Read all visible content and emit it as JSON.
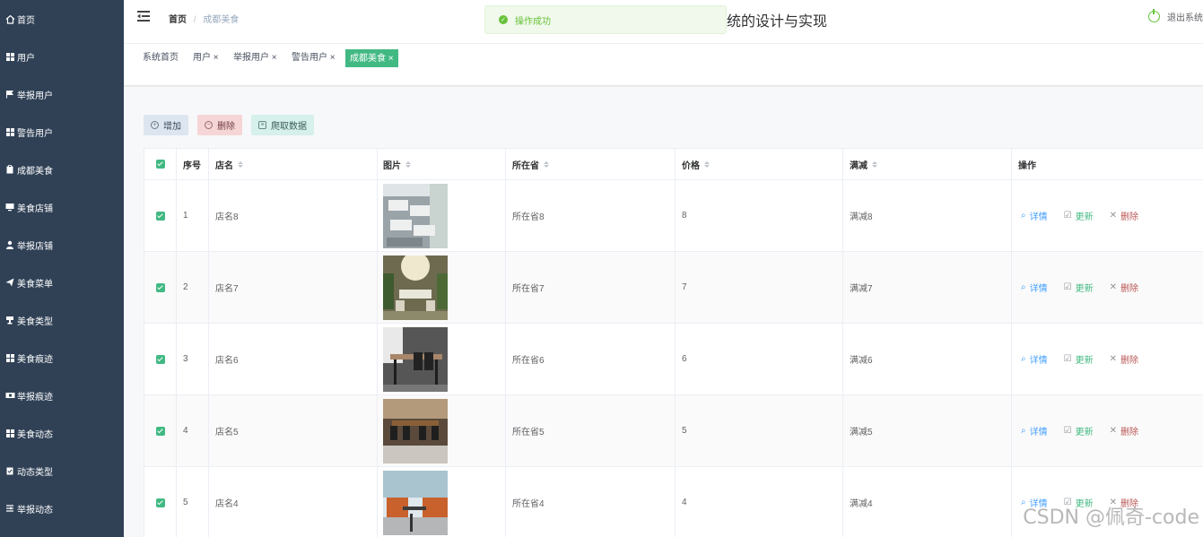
{
  "sidebar": {
    "items": [
      {
        "label": "首页",
        "icon": "home-icon"
      },
      {
        "label": "用户",
        "icon": "grid-icon"
      },
      {
        "label": "举报用户",
        "icon": "flag-icon"
      },
      {
        "label": "警告用户",
        "icon": "grid-icon"
      },
      {
        "label": "成都美食",
        "icon": "clipboard-icon"
      },
      {
        "label": "美食店铺",
        "icon": "monitor-icon"
      },
      {
        "label": "举报店铺",
        "icon": "user-icon"
      },
      {
        "label": "美食菜单",
        "icon": "send-icon"
      },
      {
        "label": "美食类型",
        "icon": "trophy-icon"
      },
      {
        "label": "美食痕迹",
        "icon": "grid-icon"
      },
      {
        "label": "举报痕迹",
        "icon": "ticket-icon"
      },
      {
        "label": "美食动态",
        "icon": "grid-icon"
      },
      {
        "label": "动态类型",
        "icon": "clipboard-icon"
      },
      {
        "label": "举报动态",
        "icon": "list-icon"
      }
    ]
  },
  "header": {
    "breadcrumb_home": "首页",
    "breadcrumb_sep": "/",
    "breadcrumb_current": "成都美食",
    "title": "统的设计与实现",
    "logout_label": "退出系统"
  },
  "toast": {
    "text": "操作成功",
    "color": "#67c23a"
  },
  "tags": [
    {
      "label": "系统首页"
    },
    {
      "label": "用户 ×"
    },
    {
      "label": "举报用户 ×"
    },
    {
      "label": "警告用户 ×"
    },
    {
      "label": "成都美食 ×"
    }
  ],
  "toolbar": {
    "add_label": "增加",
    "delete_label": "删除",
    "crawl_label": "爬取数据"
  },
  "table": {
    "columns": [
      "序号",
      "店名",
      "图片",
      "所在省",
      "价格",
      "满减",
      "操作"
    ],
    "rows": [
      {
        "no": "1",
        "name": "店名8",
        "province": "所在省8",
        "price": "8",
        "discount": "满减8"
      },
      {
        "no": "2",
        "name": "店名7",
        "province": "所在省7",
        "price": "7",
        "discount": "满减7"
      },
      {
        "no": "3",
        "name": "店名6",
        "province": "所在省6",
        "price": "6",
        "discount": "满减6"
      },
      {
        "no": "4",
        "name": "店名5",
        "province": "所在省5",
        "price": "5",
        "discount": "满减5"
      },
      {
        "no": "5",
        "name": "店名4",
        "province": "所在省4",
        "price": "4",
        "discount": "满减4"
      }
    ],
    "actions": {
      "detail": "详情",
      "update": "更新",
      "remove": "删除"
    }
  },
  "watermark": "CSDN @佩奇-code",
  "colors": {
    "sidebar": "#304156",
    "accent": "#42b983"
  }
}
